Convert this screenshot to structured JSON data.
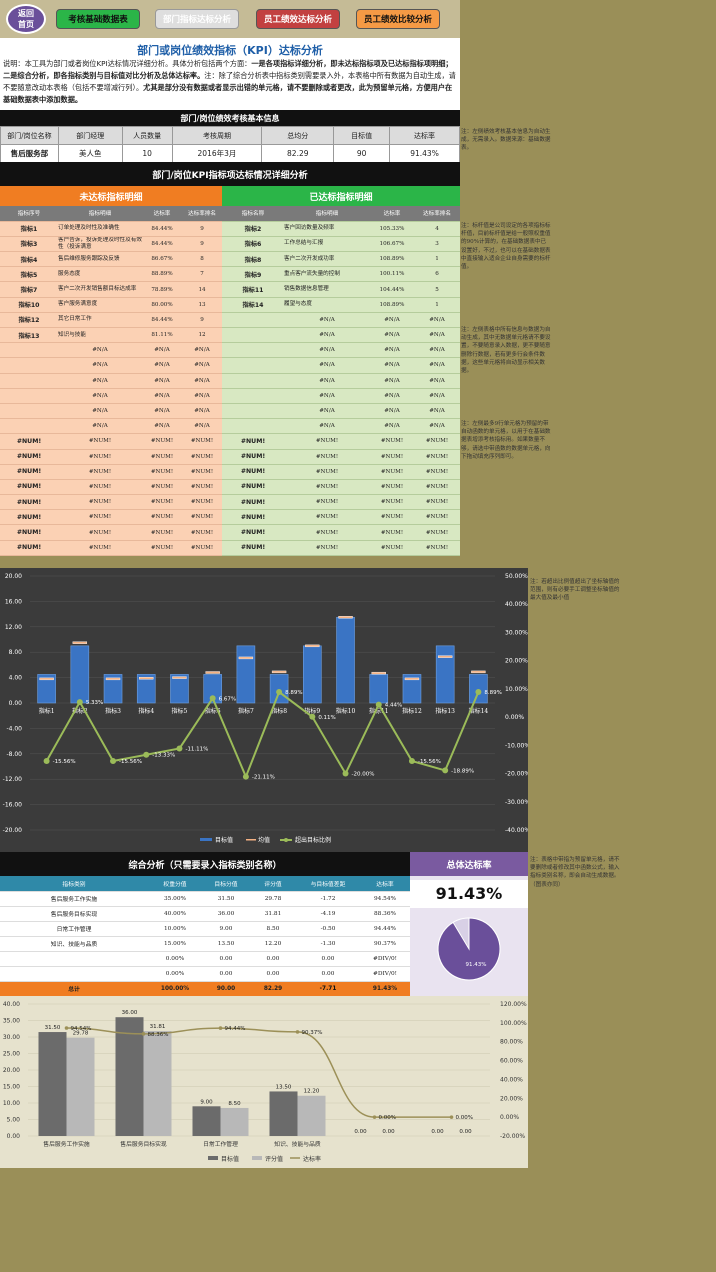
{
  "nav": {
    "home": [
      "返回",
      "首页"
    ],
    "b1": "考核基础数据表",
    "b2": "部门指标达标分析",
    "b3": "员工绩效达标分析",
    "b4": "员工绩效比较分析"
  },
  "title": "部门或岗位绩效指标（KPI）达标分析",
  "desc": {
    "p1": "说明：本工具为部门或者岗位KPI达标情况详细分析。具体分析包括两个方面：",
    "b1": "一是各项指标详细分析，即未达标指标项及已达标指标项明细；二是综合分析，即各指标类别与目标值对比分析及总体达标率。",
    "p2": "注：除了综合分析表中指标类别需要录入外，本表格中所有数据为自动生成，请不要随意改动本表格（包括不要增减行列）。",
    "b2": "尤其是部分没有数据或者显示出错的单元格，请不要删除或者更改，此为预留单元格，方便用户在基础数据表中添加数据。"
  },
  "info": {
    "title": "部门/岗位绩效考核基本信息",
    "headers": [
      "部门/岗位名称",
      "部门经理",
      "人员数量",
      "考核周期",
      "总均分",
      "目标值",
      "达标率"
    ],
    "values": [
      "售后服务部",
      "美人鱼",
      "10",
      "2016年3月",
      "82.29",
      "90",
      "91.43%"
    ]
  },
  "kpi": {
    "title": "部门/岗位KPI指标项达标情况详细分析",
    "left_title": "未达标指标明细",
    "right_title": "已达标指标明细",
    "left_headers": [
      "指标序号",
      "指标明细",
      "达标率",
      "达标率排名"
    ],
    "right_headers": [
      "指标名称",
      "指标明细",
      "达标率",
      "达标率排名"
    ],
    "left_rows": [
      [
        "指标1",
        "订单处理及时性及准确性",
        "84.44%",
        "9"
      ],
      [
        "指标3",
        "客户告诉，投诉处理及时性及有效性（投诉满意",
        "84.44%",
        "9"
      ],
      [
        "指标4",
        "售后维修服务跟踪及反馈",
        "86.67%",
        "8"
      ],
      [
        "指标5",
        "服务态度",
        "88.89%",
        "7"
      ],
      [
        "指标7",
        "客户二次开发销售额目标达成率",
        "78.89%",
        "14"
      ],
      [
        "指标10",
        "客户服务满意度",
        "80.00%",
        "13"
      ],
      [
        "指标12",
        "其它日常工作",
        "84.44%",
        "9"
      ],
      [
        "指标13",
        "知识与技能",
        "81.11%",
        "12"
      ],
      [
        "",
        "#N/A",
        "#N/A",
        "#N/A"
      ],
      [
        "",
        "#N/A",
        "#N/A",
        "#N/A"
      ],
      [
        "",
        "#N/A",
        "#N/A",
        "#N/A"
      ],
      [
        "",
        "#N/A",
        "#N/A",
        "#N/A"
      ],
      [
        "",
        "#N/A",
        "#N/A",
        "#N/A"
      ],
      [
        "",
        "#N/A",
        "#N/A",
        "#N/A"
      ],
      [
        "#NUM!",
        "#NUM!",
        "#NUM!",
        "#NUM!"
      ],
      [
        "#NUM!",
        "#NUM!",
        "#NUM!",
        "#NUM!"
      ],
      [
        "#NUM!",
        "#NUM!",
        "#NUM!",
        "#NUM!"
      ],
      [
        "#NUM!",
        "#NUM!",
        "#NUM!",
        "#NUM!"
      ],
      [
        "#NUM!",
        "#NUM!",
        "#NUM!",
        "#NUM!"
      ],
      [
        "#NUM!",
        "#NUM!",
        "#NUM!",
        "#NUM!"
      ],
      [
        "#NUM!",
        "#NUM!",
        "#NUM!",
        "#NUM!"
      ],
      [
        "#NUM!",
        "#NUM!",
        "#NUM!",
        "#NUM!"
      ]
    ],
    "right_rows": [
      [
        "指标2",
        "客户回访数量及频率",
        "105.33%",
        "4"
      ],
      [
        "指标6",
        "工作总结与汇报",
        "106.67%",
        "3"
      ],
      [
        "指标8",
        "客户二次开发成功率",
        "108.89%",
        "1"
      ],
      [
        "指标9",
        "重点客户流失量的控制",
        "100.11%",
        "6"
      ],
      [
        "指标11",
        "销售数据信息管理",
        "104.44%",
        "5"
      ],
      [
        "指标14",
        "履望与态度",
        "108.89%",
        "1"
      ],
      [
        "",
        "#N/A",
        "#N/A",
        "#N/A"
      ],
      [
        "",
        "#N/A",
        "#N/A",
        "#N/A"
      ],
      [
        "",
        "#N/A",
        "#N/A",
        "#N/A"
      ],
      [
        "",
        "#N/A",
        "#N/A",
        "#N/A"
      ],
      [
        "",
        "#N/A",
        "#N/A",
        "#N/A"
      ],
      [
        "",
        "#N/A",
        "#N/A",
        "#N/A"
      ],
      [
        "",
        "#N/A",
        "#N/A",
        "#N/A"
      ],
      [
        "",
        "#N/A",
        "#N/A",
        "#N/A"
      ],
      [
        "#NUM!",
        "#NUM!",
        "#NUM!",
        "#NUM!"
      ],
      [
        "#NUM!",
        "#NUM!",
        "#NUM!",
        "#NUM!"
      ],
      [
        "#NUM!",
        "#NUM!",
        "#NUM!",
        "#NUM!"
      ],
      [
        "#NUM!",
        "#NUM!",
        "#NUM!",
        "#NUM!"
      ],
      [
        "#NUM!",
        "#NUM!",
        "#NUM!",
        "#NUM!"
      ],
      [
        "#NUM!",
        "#NUM!",
        "#NUM!",
        "#NUM!"
      ],
      [
        "#NUM!",
        "#NUM!",
        "#NUM!",
        "#NUM!"
      ],
      [
        "#NUM!",
        "#NUM!",
        "#NUM!",
        "#NUM!"
      ]
    ]
  },
  "notes": {
    "n1": "注：左侧绩效考核基本信息为自动生成，无需录入。数据来源：基础数据表。",
    "n2": "注：标杆值是公司设定的各项指标标杆值，目前标杆值是给一般照权重值的90%计算的，在基础数据表中已设置好，不过，也可以在基础数据表中直接输入适合企业自身需要的标杆值。",
    "n3": "注：左侧表格中所有信息与数据为自动生成，其中无数据单元格请不要设置，不要随意录入数据，更不要随意删除行数据，若有更多行会条件数据，这些单元格将自动显示相关数据。",
    "n4": "注：左侧最多9行单元格为预留的带自动函数的单元格，以用于在基础数据表增添考核指标用。如果数量不够，请选中带函数的数据单元格，向下拖动填充序列即可。",
    "n5": "注：若超出比例值超出了坐标轴值的范围，则有必要手工调整坐标轴值的最大值及最小值",
    "n6": "注：表格中带指为预留单元格，请不要删除或者修改其中函数公式，输入指标类别名称，即会自动生成数据。（图表亦同）"
  },
  "chart_data": [
    {
      "type": "bar",
      "categories": [
        "指标1",
        "指标2",
        "指标3",
        "指标4",
        "指标5",
        "指标6",
        "指标7",
        "指标8",
        "指标9",
        "指标10",
        "指标11",
        "指标12",
        "指标13",
        "指标14"
      ],
      "series": [
        {
          "name": "目标值",
          "values": [
            4.5,
            9,
            4.5,
            4.5,
            4.5,
            4.5,
            9,
            4.5,
            9,
            13.5,
            4.5,
            4.5,
            9,
            4.5
          ]
        },
        {
          "name": "均值",
          "values": [
            3.8,
            9.5,
            3.8,
            3.9,
            4,
            4.8,
            7.1,
            4.9,
            9,
            13.5,
            4.7,
            3.8,
            7.3,
            4.9
          ]
        },
        {
          "name": "超出目标比例",
          "values": [
            -15.56,
            5.33,
            -15.56,
            -13.33,
            -11.11,
            6.67,
            -21.11,
            8.89,
            0.11,
            -20.0,
            4.44,
            -15.56,
            -18.89,
            8.89
          ],
          "labels": [
            "-15.56%",
            "5.33%",
            "-15.56%",
            "-13.33%",
            "-11.11%",
            "6.67%",
            "-21.11%",
            "8.89%",
            "0.11%",
            "-20.00%",
            "4.44%",
            "-15.56%",
            "-18.89%",
            "8.89%"
          ]
        }
      ],
      "yticks": [
        "20.00",
        "16.00",
        "12.00",
        "8.00",
        "4.00",
        "0.00",
        "-4.00",
        "-8.00",
        "-12.00",
        "-16.00",
        "-20.00"
      ],
      "ylim": [
        -20,
        20
      ],
      "y2ticks": [
        "50.00%",
        "40.00%",
        "30.00%",
        "20.00%",
        "10.00%",
        "0.00%",
        "-10.00%",
        "-20.00%",
        "-30.00%",
        "-40.00%"
      ],
      "y2lim": [
        -40,
        50
      ],
      "legend": "bottom"
    },
    {
      "type": "bar",
      "categories": [
        "售后服务工作实施",
        "售后服务目标实现",
        "日常工作管理",
        "知识、技能与品质",
        "",
        ""
      ],
      "series": [
        {
          "name": "目标值",
          "values": [
            31.5,
            36,
            9,
            13.5,
            0,
            0
          ]
        },
        {
          "name": "评分值",
          "values": [
            29.78,
            31.81,
            8.5,
            12.2,
            0,
            0
          ]
        },
        {
          "name": "达标率",
          "values": [
            94.54,
            88.36,
            94.44,
            90.37,
            0,
            0
          ]
        }
      ],
      "bar_labels": {
        "target": [
          "31.50",
          "36.00",
          "9.00",
          "13.50",
          "0.00",
          "0.00"
        ],
        "score": [
          "29.78",
          "31.81",
          "8.50",
          "12.20",
          "0.00",
          "0.00"
        ],
        "rate": [
          "94.54%",
          "88.36%",
          "94.44%",
          "90.37%",
          "0.00%",
          "0.00%"
        ]
      },
      "yticks": [
        "40.00",
        "35.00",
        "30.00",
        "25.00",
        "20.00",
        "15.00",
        "10.00",
        "5.00",
        "0.00"
      ],
      "ylim": [
        0,
        40
      ],
      "y2ticks": [
        "120.00%",
        "100.00%",
        "80.00%",
        "60.00%",
        "40.00%",
        "20.00%",
        "0.00%",
        "-20.00%"
      ],
      "y2lim": [
        -20,
        120
      ],
      "legend": "bottom"
    },
    {
      "type": "pie",
      "series": [
        {
          "name": "达标率",
          "values": [
            91.43,
            8.57
          ]
        }
      ],
      "label": "91.43%",
      "colors": [
        "#6a4f9a",
        "#d8d0e6"
      ]
    }
  ],
  "synth": {
    "title": "综合分析（只需要录入指标类别名称）",
    "ach_title": "总体达标率",
    "ach_value": "91.43%",
    "headers": [
      "指标类别",
      "权重分值",
      "目标分值",
      "评分值",
      "与目标值差距",
      "达标率"
    ],
    "rows": [
      [
        "售后服务工作实施",
        "35.00%",
        "31.50",
        "29.78",
        "-1.72",
        "94.54%"
      ],
      [
        "售后服务目标实现",
        "40.00%",
        "36.00",
        "31.81",
        "-4.19",
        "88.36%"
      ],
      [
        "日常工作管理",
        "10.00%",
        "9.00",
        "8.50",
        "-0.50",
        "94.44%"
      ],
      [
        "知识、技能与品质",
        "15.00%",
        "13.50",
        "12.20",
        "-1.30",
        "90.37%"
      ],
      [
        "",
        "0.00%",
        "0.00",
        "0.00",
        "0.00",
        "#DIV/0!"
      ],
      [
        "",
        "0.00%",
        "0.00",
        "0.00",
        "0.00",
        "#DIV/0!"
      ]
    ],
    "total": [
      "总计",
      "100.00%",
      "90.00",
      "82.29",
      "-7.71",
      "91.43%"
    ]
  },
  "colors": {
    "orange": "#f07d22",
    "green": "#2bb548",
    "purple": "#6a4f9a",
    "bar_blue": "#3a74c4",
    "line": "#9bbb59"
  }
}
